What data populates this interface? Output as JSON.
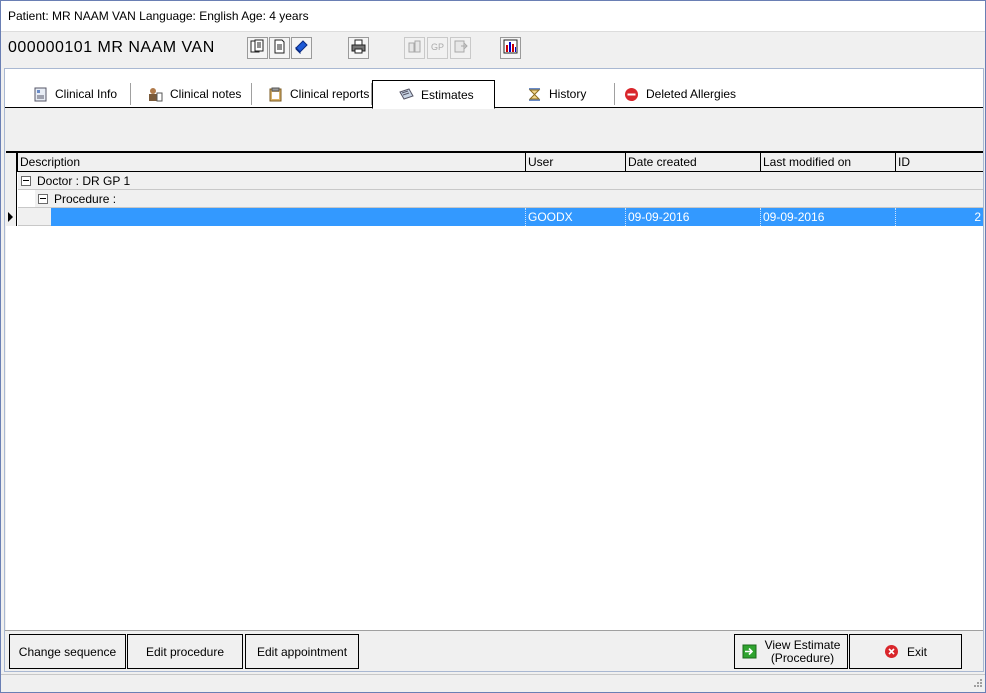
{
  "title": {
    "text": "Patient: MR NAAM VAN  Language: English Age: 4 years"
  },
  "header": {
    "patient_line": "000000101  MR NAAM VAN"
  },
  "toolbar": {
    "buttons": [
      {
        "name": "copy-doc-icon",
        "enabled": true
      },
      {
        "name": "document-icon",
        "enabled": true
      },
      {
        "name": "book-icon",
        "enabled": true
      },
      {
        "name": "print-icon",
        "enabled": true
      },
      {
        "name": "sort-icon",
        "enabled": false
      },
      {
        "name": "gp-icon",
        "enabled": false
      },
      {
        "name": "export-icon",
        "enabled": false
      },
      {
        "name": "chart-icon",
        "enabled": true
      }
    ]
  },
  "tabs": [
    {
      "label": "Clinical Info",
      "icon": "clinical-info-icon"
    },
    {
      "label": "Clinical notes",
      "icon": "clinical-notes-icon"
    },
    {
      "label": "Clinical reports",
      "icon": "clipboard-icon"
    },
    {
      "label": "Estimates",
      "icon": "estimates-icon",
      "active": true
    },
    {
      "label": "History",
      "icon": "hourglass-icon"
    },
    {
      "label": "Deleted Allergies",
      "icon": "no-entry-icon"
    }
  ],
  "grid": {
    "columns": [
      "Description",
      "User",
      "Date created",
      "Last modified on",
      "ID"
    ],
    "groups": {
      "doctor": "Doctor : DR GP 1",
      "procedure": "Procedure :"
    },
    "rows": [
      {
        "description": "",
        "user": "GOODX",
        "date_created": "09-09-2016",
        "last_modified": "09-09-2016",
        "id": "2"
      }
    ]
  },
  "buttons": {
    "change_sequence": "Change sequence",
    "edit_procedure": "Edit procedure",
    "edit_appointment": "Edit appointment",
    "view_estimate_line1": "View Estimate",
    "view_estimate_line2": "(Procedure)",
    "exit": "Exit"
  },
  "colors": {
    "selection": "#3399ff",
    "accent_border": "#6a7fb4"
  }
}
